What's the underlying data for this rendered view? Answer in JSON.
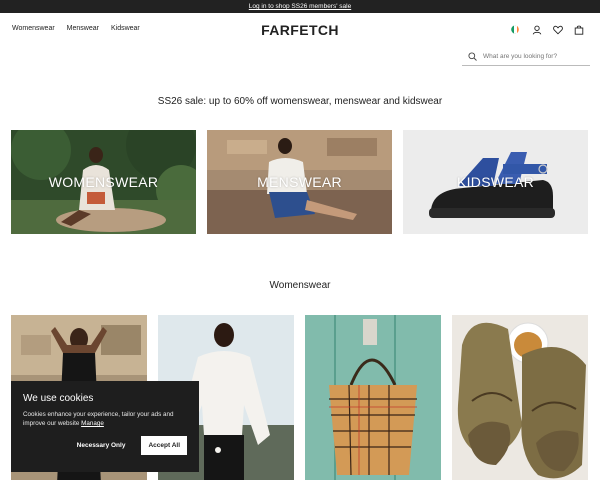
{
  "topbar": {
    "text": "Log in to shop SS26 members' sale"
  },
  "nav": {
    "items": [
      "Womenswear",
      "Menswear",
      "Kidswear"
    ]
  },
  "brand": {
    "logo": "FARFETCH"
  },
  "header_icons": [
    "flag-icon",
    "account-icon",
    "wishlist-icon",
    "bag-icon"
  ],
  "search": {
    "placeholder": "What are you looking for?"
  },
  "promo": {
    "text": "SS26 sale: up to 60% off womenswear, menswear and kidswear"
  },
  "categories": [
    {
      "label": "WOMENSWEAR"
    },
    {
      "label": "MENSWEAR"
    },
    {
      "label": "KIDSWEAR"
    }
  ],
  "section": {
    "title": "Womenswear"
  },
  "cookie": {
    "title": "We use cookies",
    "description": "Cookies enhance your experience, tailor your ads and improve our website",
    "manage_link": "Manage",
    "necessary_label": "Necessary Only",
    "accept_label": "Accept All"
  },
  "colors": {
    "topbar": "#222222",
    "cookie_bg": "#1e1e1e",
    "flag": [
      "#169b62",
      "#ffffff",
      "#ff883e"
    ]
  }
}
